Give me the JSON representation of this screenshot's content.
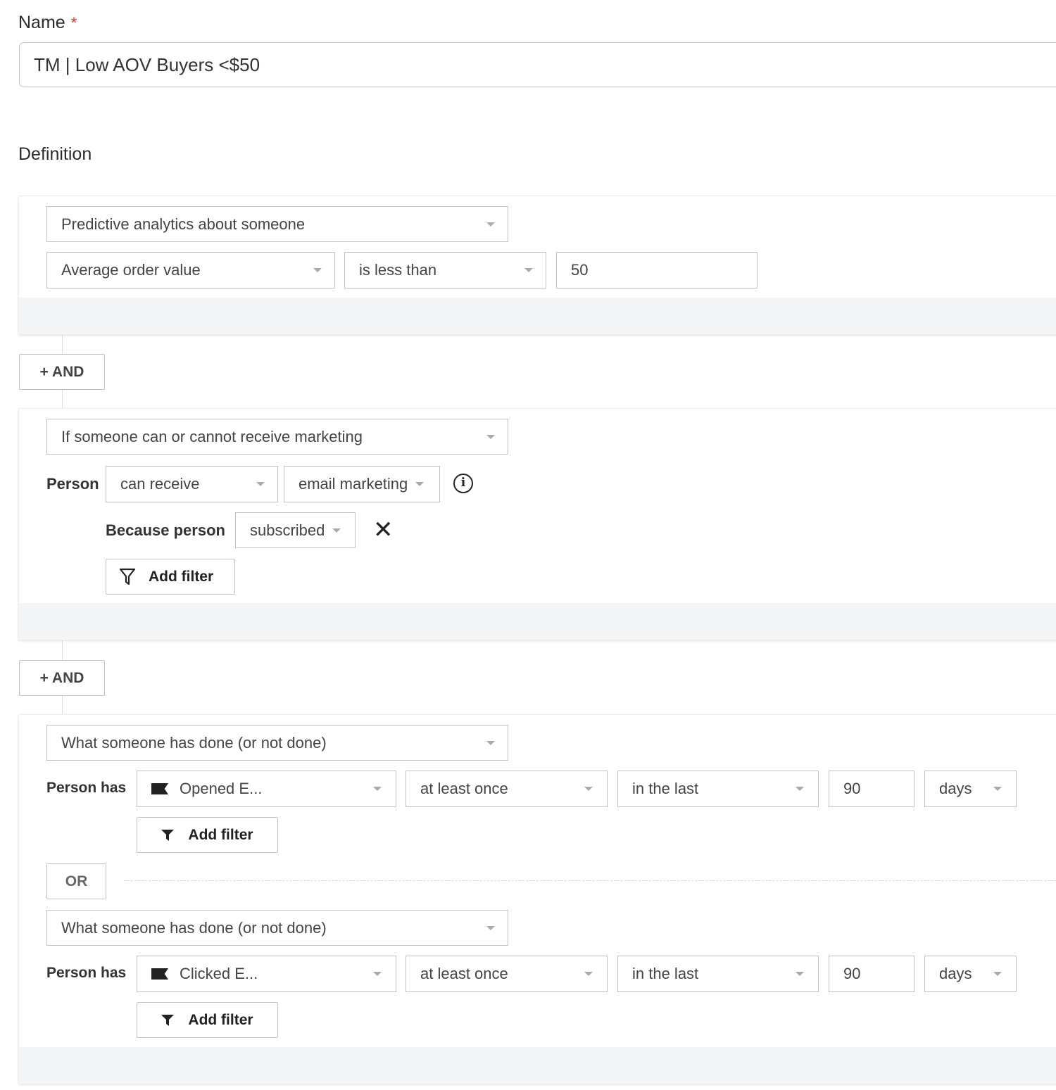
{
  "name": {
    "label": "Name",
    "required_mark": "*",
    "value": "TM | Low AOV Buyers <$50"
  },
  "definition": {
    "title": "Definition"
  },
  "and_label": "+ AND",
  "or_label": "OR",
  "block1": {
    "type": "Predictive analytics about someone",
    "metric": "Average order value",
    "operator": "is less than",
    "value": "50"
  },
  "block2": {
    "type": "If someone can or cannot receive marketing",
    "person_label": "Person",
    "can": "can receive",
    "channel": "email marketing",
    "because_label": "Because person",
    "reason": "subscribed",
    "add_filter": "Add filter"
  },
  "block3": {
    "conditions": [
      {
        "type": "What someone has done (or not done)",
        "person_label": "Person has",
        "metric": "Opened E...",
        "frequency": "at least once",
        "time": "in the last",
        "count": "90",
        "unit": "days",
        "add_filter": "Add filter"
      },
      {
        "type": "What someone has done (or not done)",
        "person_label": "Person has",
        "metric": "Clicked E...",
        "frequency": "at least once",
        "time": "in the last",
        "count": "90",
        "unit": "days",
        "add_filter": "Add filter"
      }
    ]
  },
  "colors": {
    "required": "#d0332b",
    "footer": "#f4f5f6",
    "border": "#bfc3c7"
  }
}
